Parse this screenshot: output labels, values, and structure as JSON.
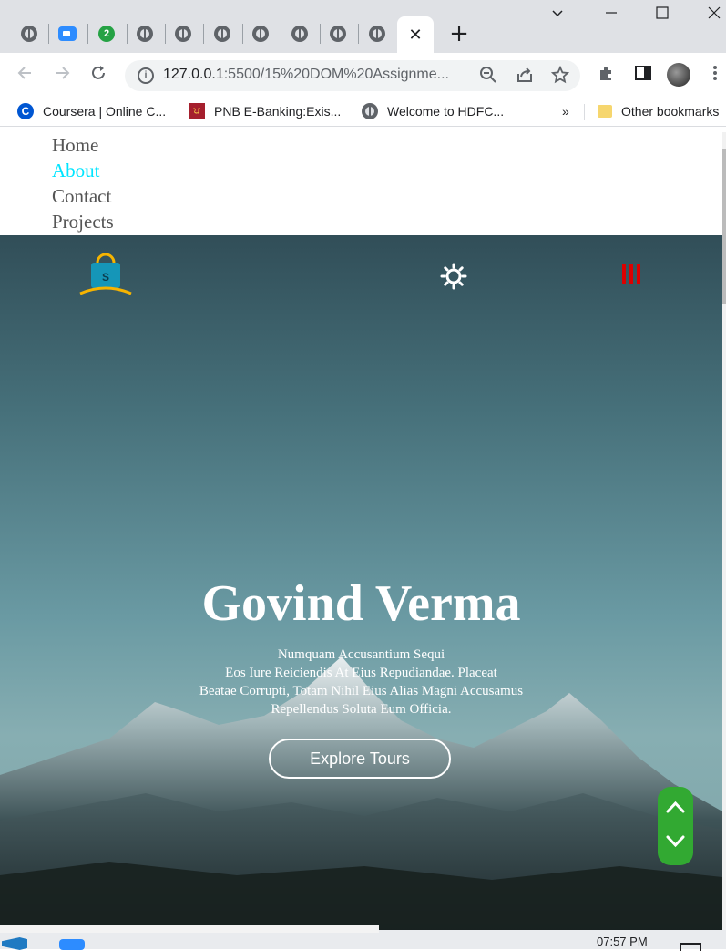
{
  "browser": {
    "tabs": [
      {
        "icon": "globe-icon"
      },
      {
        "icon": "zoom-icon"
      },
      {
        "icon": "whatsapp-badge-icon",
        "badge": "2"
      },
      {
        "icon": "globe-icon"
      },
      {
        "icon": "globe-icon"
      },
      {
        "icon": "globe-icon"
      },
      {
        "icon": "globe-icon"
      },
      {
        "icon": "globe-icon"
      },
      {
        "icon": "globe-icon"
      },
      {
        "icon": "globe-icon"
      }
    ],
    "active_tab_close": "✕",
    "new_tab": "+",
    "url_host": "127.0.0.1",
    "url_path": ":5500/15%20DOM%20Assignme...",
    "bookmarks": [
      {
        "label": "Coursera | Online C...",
        "icon": "coursera-icon"
      },
      {
        "label": "PNB E-Banking:Exis...",
        "icon": "pnb-icon"
      },
      {
        "label": "Welcome to HDFC...",
        "icon": "globe-icon"
      }
    ],
    "bookmarks_overflow": "»",
    "other_bookmarks": "Other bookmarks"
  },
  "nav": {
    "links": [
      "Home",
      "About",
      "Contact",
      "Projects"
    ],
    "active_index": 1
  },
  "hero": {
    "logo_letter": "S",
    "title": "Govind Verma",
    "text_lines": [
      "Numquam Accusantium Sequi",
      "Eos Iure Reiciendis At Eius Repudiandae. Placeat",
      "Beatae Corrupti, Totam Nihil Eius Alias Magni Accusamus",
      "Repellendus Soluta Eum Officia."
    ],
    "button_label": "Explore Tours"
  },
  "colors": {
    "accent_active_link": "#00e5ff",
    "menu_icon": "#dd0000",
    "scroll_control": "#32a932"
  },
  "taskbar": {
    "time": "07:57 PM"
  }
}
